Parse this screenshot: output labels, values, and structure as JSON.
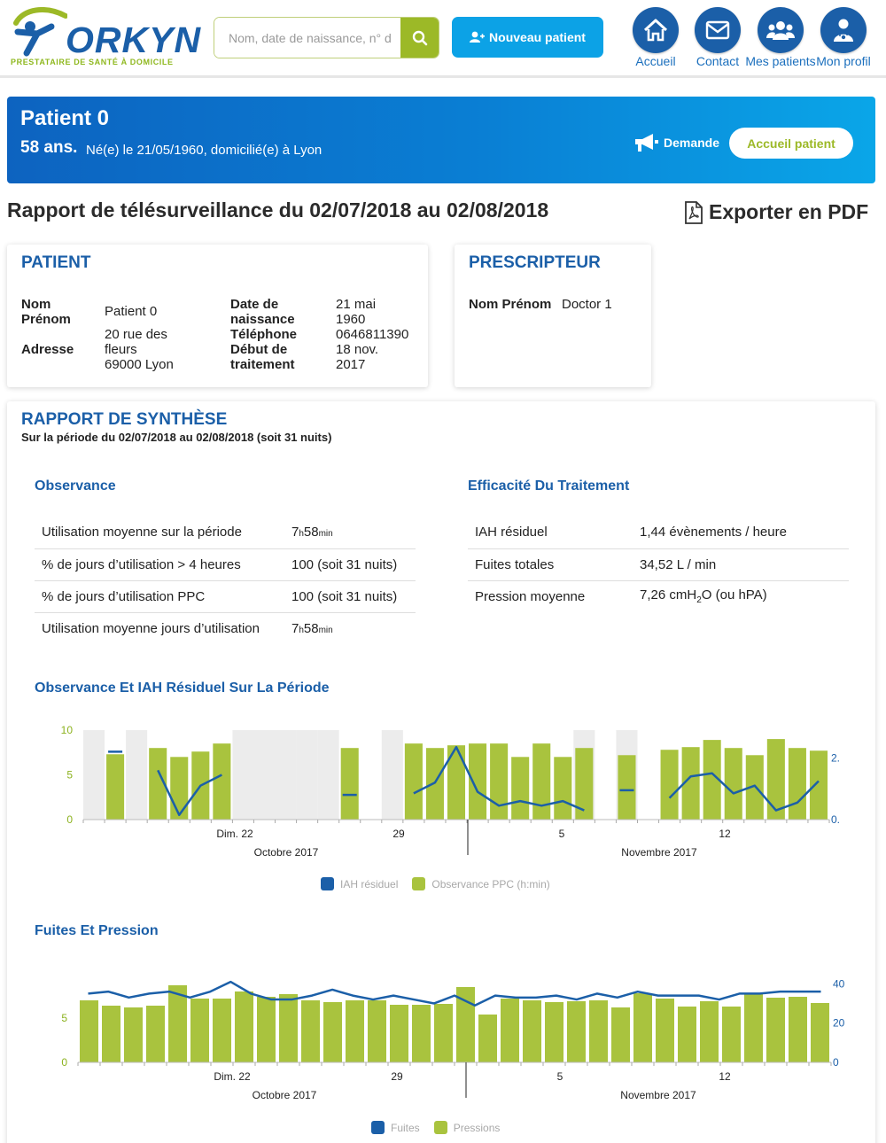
{
  "brand": {
    "logo_text": "ORKYN",
    "tagline": "PRESTATAIRE DE SANTÉ À DOMICILE",
    "blue": "#1b5fa8",
    "green": "#9cb927",
    "light_blue": "#0ca2e6"
  },
  "header": {
    "search_placeholder": "Nom, date de naissance, n° d",
    "search_icon": "search-icon",
    "new_patient_label": "Nouveau patient",
    "nav": [
      {
        "label": "Accueil",
        "icon": "home-icon"
      },
      {
        "label": "Contact",
        "icon": "envelope-icon"
      },
      {
        "label": "Mes patients",
        "icon": "users-icon"
      },
      {
        "label": "Mon profil",
        "icon": "doctor-icon"
      }
    ]
  },
  "banner": {
    "patient_name": "Patient 0",
    "age": "58 ans.",
    "info": "Né(e) le 21/05/1960, domicilié(e) à Lyon",
    "demande_label": "Demande",
    "accueil_label": "Accueil patient"
  },
  "report": {
    "title": "Rapport de télésurveillance du 02/07/2018 au 02/08/2018",
    "export_label": "Exporter en PDF"
  },
  "patient_card": {
    "title": "PATIENT",
    "nom_label": "Nom\nPrénom",
    "nom_value": "Patient 0",
    "adresse_label": "Adresse",
    "adresse_value": "20 rue des\nfleurs\n69000 Lyon",
    "naissance_label": "Date de\nnaissance",
    "naissance_value": "21 mai\n1960",
    "telephone_label": "Téléphone",
    "telephone_value": "0646811390",
    "debut_label": "Début de\ntraitement",
    "debut_value": "18 nov.\n2017"
  },
  "prescripteur_card": {
    "title": "PRESCRIPTEUR",
    "nom_label": "Nom Prénom",
    "nom_value": "Doctor 1"
  },
  "synthese": {
    "title": "RAPPORT DE SYNTHÈSE",
    "period": "Sur la période du 02/07/2018 au 02/08/2018 (soit 31 nuits)",
    "observance_title": "Observance",
    "observance_rows": [
      {
        "label": "Utilisation moyenne sur la période",
        "value_h": "7",
        "value_m": "58"
      },
      {
        "label": "% de jours d’utilisation > 4 heures",
        "value": "100 (soit 31 nuits)"
      },
      {
        "label": "% de jours d’utilisation PPC",
        "value": "100 (soit 31 nuits)"
      },
      {
        "label": "Utilisation moyenne jours d’utilisation",
        "value_h": "7",
        "value_m": "58"
      }
    ],
    "unit_h": "h",
    "unit_min": "min",
    "efficacite_title": "Efficacité Du Traitement",
    "efficacite_rows": [
      {
        "label": "IAH résiduel",
        "value": "1,44 évènements / heure"
      },
      {
        "label": "Fuites totales",
        "value": "34,52 L / min"
      },
      {
        "label": "Pression moyenne",
        "value_pre": "7,26 cmH",
        "value_sub": "2",
        "value_post": "O (ou hPA)"
      }
    ]
  },
  "chart_data": [
    {
      "type": "bar",
      "title": "Observance Et IAH Résiduel Sur La Période",
      "x_tick_labels": [
        "Dim. 22",
        "29",
        "5",
        "12"
      ],
      "month_labels": [
        "Octobre 2017",
        "Novembre 2017"
      ],
      "ylim_left": [
        0,
        10
      ],
      "y_ticks_left": [
        "0",
        "5",
        "10"
      ],
      "y_ticks_right": [
        "0.",
        "2."
      ],
      "legend": [
        "IAH résiduel",
        "Observance PPC (h:min)"
      ],
      "legend_position": "bottom",
      "no_data_indices": [
        0,
        2,
        7,
        8,
        9,
        10,
        11,
        14,
        23,
        25
      ],
      "series": [
        {
          "name": "Observance PPC (h:min)",
          "color": "#a9c33e",
          "values": [
            null,
            7.3,
            null,
            8.0,
            7.0,
            7.6,
            8.5,
            null,
            null,
            null,
            null,
            null,
            8.0,
            null,
            null,
            8.5,
            8.0,
            8.3,
            8.5,
            8.5,
            7.0,
            8.5,
            7.0,
            8.0,
            null,
            7.2,
            null,
            7.8,
            8.1,
            8.9,
            8.0,
            7.2,
            9.0,
            8.0,
            7.7
          ]
        },
        {
          "name": "IAH résiduel",
          "color": "#1b5fa8",
          "values": [
            null,
            2.2,
            null,
            1.6,
            0.15,
            1.1,
            1.45,
            null,
            null,
            null,
            null,
            null,
            0.8,
            null,
            null,
            0.85,
            1.2,
            2.35,
            0.9,
            0.45,
            0.6,
            0.45,
            0.6,
            0.3,
            null,
            0.95,
            null,
            0.7,
            1.4,
            1.5,
            0.85,
            1.1,
            0.3,
            0.55,
            1.25
          ]
        }
      ]
    },
    {
      "type": "bar",
      "title": "Fuites Et Pression",
      "x_tick_labels": [
        "Dim. 22",
        "29",
        "5",
        "12"
      ],
      "month_labels": [
        "Octobre 2017",
        "Novembre 2017"
      ],
      "y_ticks_left": [
        "0",
        "5"
      ],
      "y_ticks_right": [
        "0",
        "20",
        "40"
      ],
      "legend": [
        "Fuites",
        "Pressions"
      ],
      "legend_position": "bottom",
      "series": [
        {
          "name": "Pressions",
          "color": "#a9c33e",
          "values": [
            7.0,
            6.4,
            6.2,
            6.4,
            8.7,
            7.2,
            7.2,
            8.0,
            7.4,
            7.7,
            7.0,
            6.8,
            7.0,
            7.0,
            6.5,
            6.5,
            6.6,
            8.5,
            5.4,
            7.2,
            7.0,
            6.8,
            6.9,
            7.0,
            6.2,
            7.8,
            7.2,
            6.3,
            6.9,
            6.3,
            7.7,
            7.3,
            7.4,
            6.7
          ]
        },
        {
          "name": "Fuites",
          "color": "#1b5fa8",
          "values": [
            35,
            36,
            33,
            35,
            36,
            33,
            36,
            41,
            35,
            32,
            32,
            34,
            37,
            34,
            32,
            34,
            32,
            30,
            34,
            29,
            34,
            33,
            33,
            34,
            32,
            35,
            33,
            36,
            34,
            34,
            34,
            32,
            35,
            35,
            36,
            36,
            36
          ]
        }
      ]
    }
  ]
}
